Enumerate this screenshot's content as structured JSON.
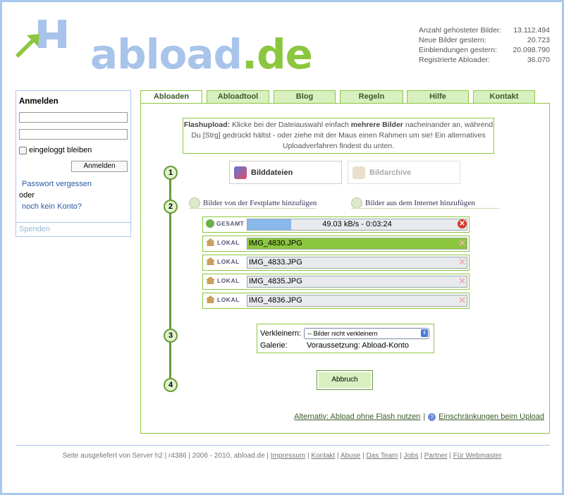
{
  "logo": {
    "text_main": "abload",
    "text_dot": ".",
    "text_tld": "de"
  },
  "stats": [
    {
      "label": "Anzahl gehosteter Bilder:",
      "value": "13.112.494"
    },
    {
      "label": "Neue Bilder gestern:",
      "value": "20.723"
    },
    {
      "label": "Einblendungen gestern:",
      "value": "20.098.790"
    },
    {
      "label": "Registrierte Abloader:",
      "value": "36.070"
    }
  ],
  "login": {
    "title": "Anmelden",
    "username": "",
    "password": "",
    "remember": "eingeloggt bleiben",
    "button": "Anmelden",
    "forgot": "Passwort vergessen",
    "or": "oder",
    "register": "noch kein Konto?",
    "donate": "Spenden"
  },
  "tabs": [
    "Abloaden",
    "Abloadtool",
    "Blog",
    "Regeln",
    "Hilfe",
    "Kontakt"
  ],
  "info": {
    "bold1": "Flashupload:",
    "text1": " Klicke bei der Dateiauswahl einfach ",
    "bold2": "mehrere Bilder",
    "text2": " nacheinander an, während Du [Strg] gedrückt hältst - oder ziehe mit der Maus einen Rahmen um sie! Ein alternatives Uploadverfahren findest du unten."
  },
  "steps": [
    "1",
    "2",
    "3",
    "4"
  ],
  "type_buttons": {
    "images": "Bilddateien",
    "archives": "Bildarchive"
  },
  "sources": {
    "local": "Bilder von der Festplatte hinzufügen",
    "internet": "Bilder aus dem Internet hinzufügen"
  },
  "total": {
    "label": "GESAMT",
    "status": "49.03 kB/s - 0:03:24",
    "progress": 0.2
  },
  "files": [
    {
      "label": "LOKAL",
      "name": "IMG_4830.JPG",
      "done": true
    },
    {
      "label": "LOKAL",
      "name": "IMG_4833.JPG",
      "done": false
    },
    {
      "label": "LOKAL",
      "name": "IMG_4835.JPG",
      "done": false
    },
    {
      "label": "LOKAL",
      "name": "IMG_4836.JPG",
      "done": false
    }
  ],
  "options": {
    "resize_label": "Verkleinern:",
    "resize_value": "-- Bilder nicht verkleinern",
    "gallery_label": "Galerie:",
    "gallery_value": "Voraussetzung: Abload-Konto"
  },
  "cancel": "Abbruch",
  "alt_link": "Alternativ: Abload ohne Flash nutzen",
  "alt_sep": "|",
  "restrictions": "Einschränkungen beim Upload",
  "footer": {
    "text": "Seite ausgeliefert von Server h2 | r4386 | 2006 - 2010, abload.de |",
    "links": [
      "Impressum",
      "Kontakt",
      "Abuse",
      "Das Team",
      "Jobs",
      "Partner",
      "Für Webmaster"
    ]
  },
  "colors": {
    "accent_green": "#8cc63f",
    "accent_blue": "#a8c8ee",
    "progress_blue": "#8ab8ea",
    "done_green": "#8cc63f"
  }
}
